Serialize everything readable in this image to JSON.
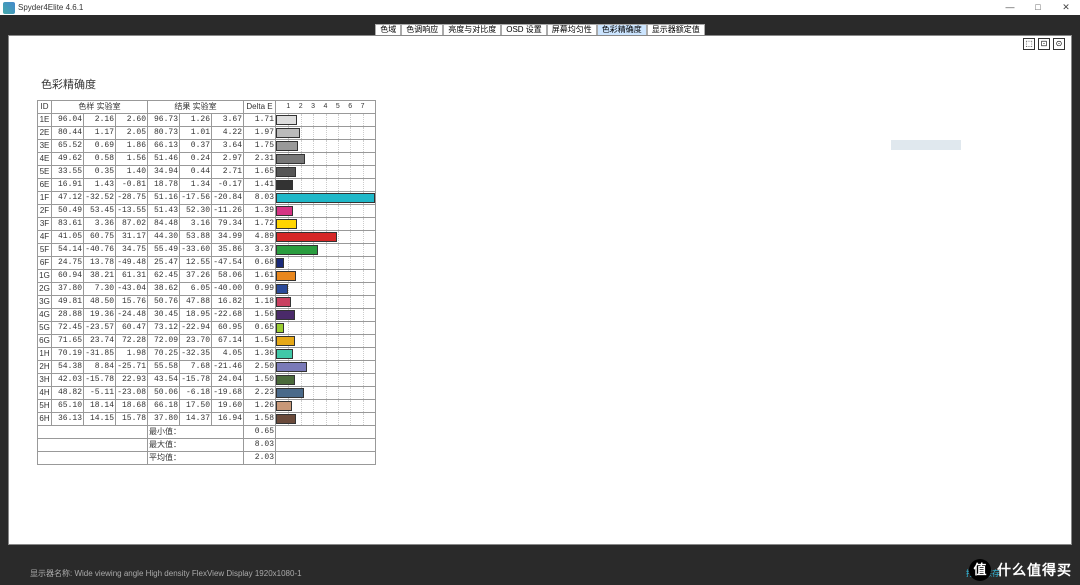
{
  "app": {
    "title": "Spyder4Elite 4.6.1"
  },
  "window_buttons": {
    "min": "—",
    "max": "□",
    "close": "✕"
  },
  "tabs": [
    {
      "label": "色域"
    },
    {
      "label": "色调响应"
    },
    {
      "label": "亮度与对比度"
    },
    {
      "label": "OSD 设置"
    },
    {
      "label": "屏幕均匀性"
    },
    {
      "label": "色彩精确度",
      "active": true
    },
    {
      "label": "显示器额定值"
    }
  ],
  "report_title": "色彩精确度",
  "headers": {
    "id": "ID",
    "sample": "色样  实验室",
    "result": "结果  实验室",
    "delta": "Delta E"
  },
  "chart_ticks": [
    "1",
    "2",
    "3",
    "4",
    "5",
    "6",
    "7"
  ],
  "chart_data": {
    "type": "bar",
    "xlabel": "",
    "ylabel": "",
    "xlim": [
      0,
      8
    ],
    "rows": [
      {
        "id": "1E",
        "s": [
          96.04,
          2.16,
          2.6
        ],
        "r": [
          96.73,
          1.26,
          3.67
        ],
        "d": 1.71,
        "c": "#ddd"
      },
      {
        "id": "2E",
        "s": [
          80.44,
          1.17,
          2.05
        ],
        "r": [
          80.73,
          1.01,
          4.22
        ],
        "d": 1.97,
        "c": "#bbb"
      },
      {
        "id": "3E",
        "s": [
          65.52,
          0.69,
          1.86
        ],
        "r": [
          66.13,
          0.37,
          3.64
        ],
        "d": 1.75,
        "c": "#999"
      },
      {
        "id": "4E",
        "s": [
          49.62,
          0.58,
          1.56
        ],
        "r": [
          51.46,
          0.24,
          2.97
        ],
        "d": 2.31,
        "c": "#777"
      },
      {
        "id": "5E",
        "s": [
          33.55,
          0.35,
          1.4
        ],
        "r": [
          34.94,
          0.44,
          2.71
        ],
        "d": 1.65,
        "c": "#555"
      },
      {
        "id": "6E",
        "s": [
          16.91,
          1.43,
          -0.81
        ],
        "r": [
          18.78,
          1.34,
          -0.17
        ],
        "d": 1.41,
        "c": "#333"
      },
      {
        "id": "1F",
        "s": [
          47.12,
          -32.52,
          -28.75
        ],
        "r": [
          51.16,
          -17.56,
          -20.84
        ],
        "d": 8.03,
        "c": "#20b8c8"
      },
      {
        "id": "2F",
        "s": [
          50.49,
          53.45,
          -13.55
        ],
        "r": [
          51.43,
          52.3,
          -11.26
        ],
        "d": 1.39,
        "c": "#d63384"
      },
      {
        "id": "3F",
        "s": [
          83.61,
          3.36,
          87.02
        ],
        "r": [
          84.48,
          3.16,
          79.34
        ],
        "d": 1.72,
        "c": "#ffd500"
      },
      {
        "id": "4F",
        "s": [
          41.05,
          60.75,
          31.17
        ],
        "r": [
          44.3,
          53.88,
          34.99
        ],
        "d": 4.89,
        "c": "#d62828"
      },
      {
        "id": "5F",
        "s": [
          54.14,
          -40.76,
          34.75
        ],
        "r": [
          55.49,
          -33.6,
          35.86
        ],
        "d": 3.37,
        "c": "#2a9d3f"
      },
      {
        "id": "6F",
        "s": [
          24.75,
          13.78,
          -49.48
        ],
        "r": [
          25.47,
          12.55,
          -47.54
        ],
        "d": 0.68,
        "c": "#1a2a7a"
      },
      {
        "id": "1G",
        "s": [
          60.94,
          38.21,
          61.31
        ],
        "r": [
          62.45,
          37.26,
          58.06
        ],
        "d": 1.61,
        "c": "#e8871e"
      },
      {
        "id": "2G",
        "s": [
          37.8,
          7.3,
          -43.04
        ],
        "r": [
          38.62,
          6.05,
          -40.0
        ],
        "d": 0.99,
        "c": "#2a4a9a"
      },
      {
        "id": "3G",
        "s": [
          49.81,
          48.5,
          15.76
        ],
        "r": [
          50.76,
          47.88,
          16.82
        ],
        "d": 1.18,
        "c": "#c84060"
      },
      {
        "id": "4G",
        "s": [
          28.88,
          19.36,
          -24.48
        ],
        "r": [
          30.45,
          18.95,
          -22.68
        ],
        "d": 1.56,
        "c": "#4a2a6a"
      },
      {
        "id": "5G",
        "s": [
          72.45,
          -23.57,
          60.47
        ],
        "r": [
          73.12,
          -22.94,
          60.95
        ],
        "d": 0.65,
        "c": "#9acd32"
      },
      {
        "id": "6G",
        "s": [
          71.65,
          23.74,
          72.28
        ],
        "r": [
          72.09,
          23.7,
          67.14
        ],
        "d": 1.54,
        "c": "#e6a817"
      },
      {
        "id": "1H",
        "s": [
          70.19,
          -31.85,
          1.98
        ],
        "r": [
          70.25,
          -32.35,
          4.05
        ],
        "d": 1.36,
        "c": "#40c8a8"
      },
      {
        "id": "2H",
        "s": [
          54.38,
          8.84,
          -25.71
        ],
        "r": [
          55.58,
          7.68,
          -21.46
        ],
        "d": 2.5,
        "c": "#7a7ab8"
      },
      {
        "id": "3H",
        "s": [
          42.03,
          -15.78,
          22.93
        ],
        "r": [
          43.54,
          -15.78,
          24.04
        ],
        "d": 1.5,
        "c": "#4a6a3a"
      },
      {
        "id": "4H",
        "s": [
          48.82,
          -5.11,
          -23.08
        ],
        "r": [
          50.06,
          -6.18,
          -19.68
        ],
        "d": 2.23,
        "c": "#4a6a8a"
      },
      {
        "id": "5H",
        "s": [
          65.1,
          18.14,
          18.68
        ],
        "r": [
          66.18,
          17.5,
          19.6
        ],
        "d": 1.26,
        "c": "#c89878"
      },
      {
        "id": "6H",
        "s": [
          36.13,
          14.15,
          15.78
        ],
        "r": [
          37.8,
          14.37,
          16.94
        ],
        "d": 1.58,
        "c": "#6a4a3a"
      }
    ]
  },
  "summary": [
    {
      "label": "最小值：",
      "value": 0.65
    },
    {
      "label": "最大值：",
      "value": 8.03
    },
    {
      "label": "平均值：",
      "value": 2.03
    }
  ],
  "footer": {
    "label": "显示器名称:",
    "value": "Wide viewing angle  High density FlexView Display 1920x1080-1"
  },
  "footer_right": "打印    保存",
  "watermark": {
    "symbol": "值",
    "text": "什么值得买"
  },
  "toolbar_icons": [
    "⬚",
    "⊡",
    "⊙"
  ]
}
